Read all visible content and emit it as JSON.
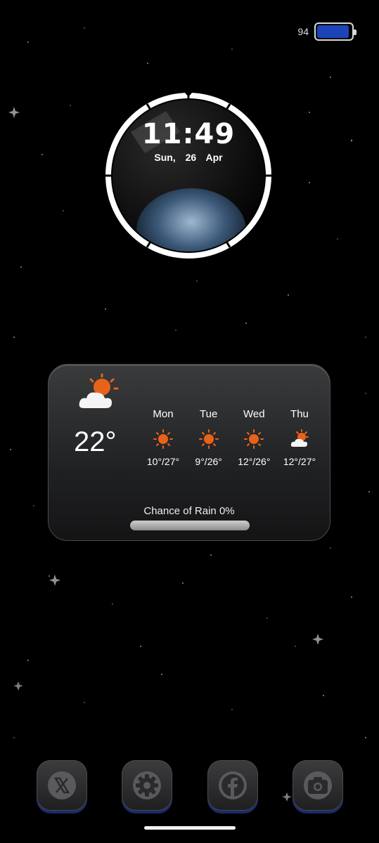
{
  "status": {
    "battery_level": "94",
    "battery_percent": 94
  },
  "clock": {
    "time": "11:49",
    "date": "Sun, 26 Apr"
  },
  "weather": {
    "current_temp": "22°",
    "current_icon": "partly-cloudy-sun-icon",
    "forecast": [
      {
        "day": "Mon",
        "icon": "sun-icon",
        "range": "10°/27°"
      },
      {
        "day": "Tue",
        "icon": "sun-icon",
        "range": "9°/26°"
      },
      {
        "day": "Wed",
        "icon": "sun-icon",
        "range": "12°/26°"
      },
      {
        "day": "Thu",
        "icon": "partly-cloudy-sun-icon",
        "range": "12°/27°"
      }
    ],
    "rain_label": "Chance of Rain 0%",
    "rain_chance": 0
  },
  "dock": [
    {
      "name": "x-app",
      "icon": "x-logo-icon"
    },
    {
      "name": "settings-app",
      "icon": "gear-icon"
    },
    {
      "name": "facebook-app",
      "icon": "facebook-icon"
    },
    {
      "name": "camera-app",
      "icon": "camera-icon"
    }
  ],
  "colors": {
    "accent_orange": "#e8621a",
    "battery_blue": "#1a44b8"
  }
}
